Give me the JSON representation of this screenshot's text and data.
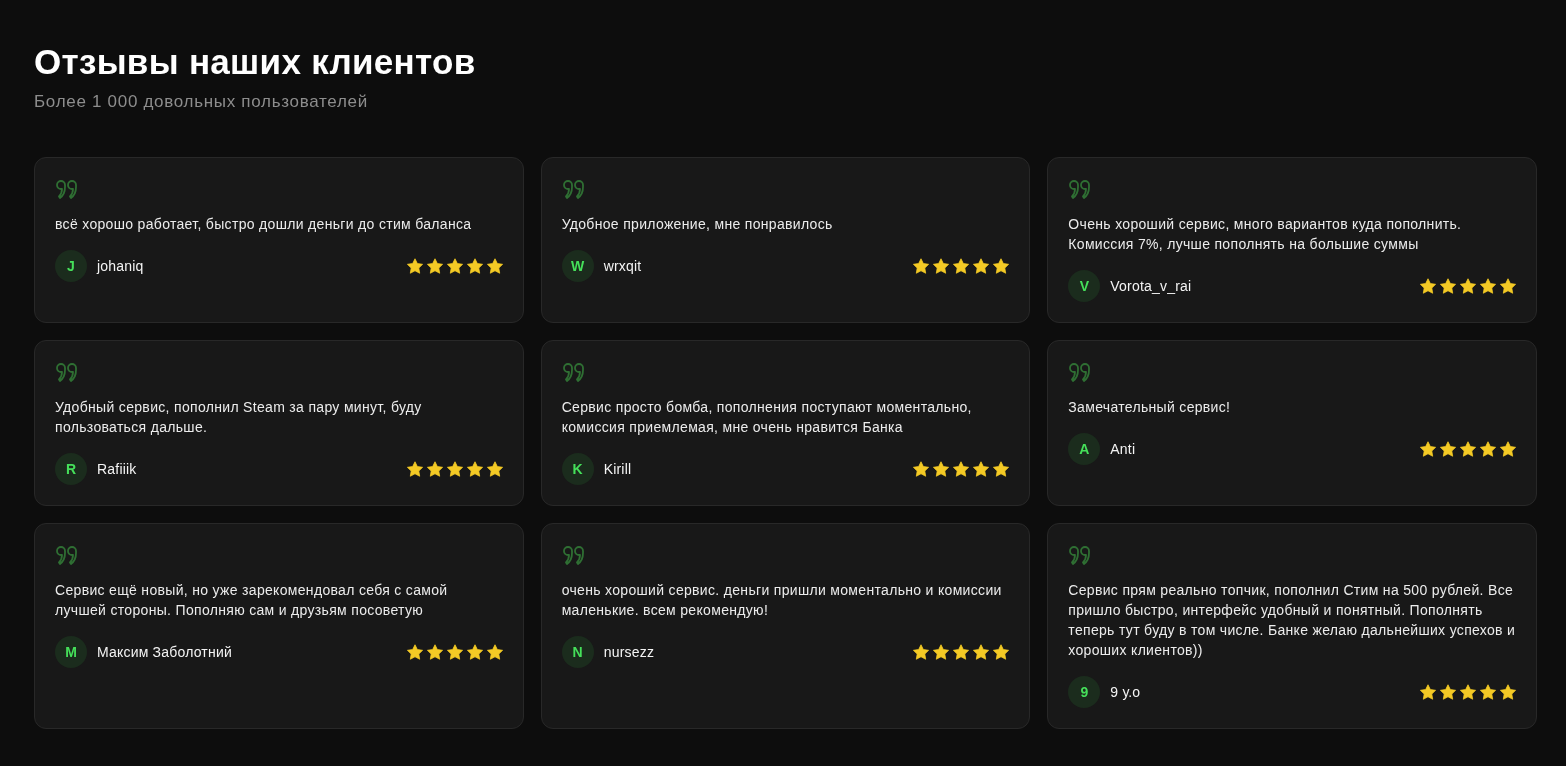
{
  "header": {
    "title": "Отзывы наших клиентов",
    "subtitle": "Более 1 000 довольных пользователей"
  },
  "reviews": [
    {
      "text": "всё хорошо работает, быстро дошли деньги до стим баланса",
      "initial": "J",
      "author": "johaniq",
      "stars": 5
    },
    {
      "text": "Удобное приложение, мне понравилось",
      "initial": "W",
      "author": "wrxqit",
      "stars": 5
    },
    {
      "text": "Очень хороший сервис, много вариантов куда пополнить. Комиссия 7%, лучше пополнять на большие суммы",
      "initial": "V",
      "author": "Vorota_v_rai",
      "stars": 5
    },
    {
      "text": "Удобный сервис, пополнил Steam за пару минут, буду пользоваться дальше.",
      "initial": "R",
      "author": "Rafiiik",
      "stars": 5
    },
    {
      "text": "Сервис просто бомба, пополнения поступают моментально, комиссия приемлемая, мне очень нравится Банка",
      "initial": "K",
      "author": "Kirill",
      "stars": 5
    },
    {
      "text": "Замечательный сервис!",
      "initial": "A",
      "author": "Anti",
      "stars": 5
    },
    {
      "text": "Сервис ещё новый, но уже зарекомендовал себя с самой лучшей стороны. Пополняю сам и друзьям посоветую",
      "initial": "M",
      "author": "Максим Заболотний",
      "stars": 5
    },
    {
      "text": "очень хороший сервис. деньги пришли моментально и комиссии маленькие. всем рекомендую!",
      "initial": "N",
      "author": "nursezz",
      "stars": 5
    },
    {
      "text": "Сервис прям реально топчик, пополнил Стим на 500 рублей. Все пришло быстро, интерфейс удобный и понятный. Пополнять теперь тут буду в том числе. Банке желаю дальнейших успехов и хороших клиентов))",
      "initial": "9",
      "author": "9 у.о",
      "stars": 5
    }
  ]
}
